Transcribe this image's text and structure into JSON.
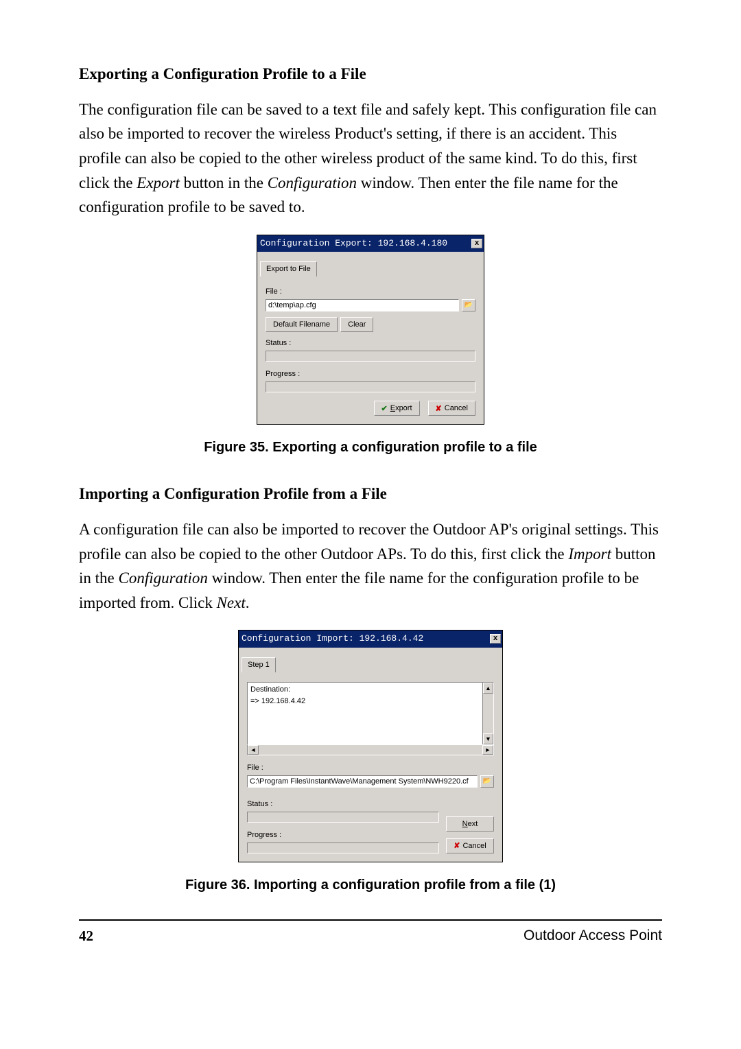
{
  "section1": {
    "heading": "Exporting a Configuration Profile to a File",
    "para_a": "The configuration file can be saved to a text file and safely kept. This configuration file can also be imported to recover the wireless Product's setting, if there is an accident. This profile can also be copied to the other wireless product of the same kind. To do this, first click the ",
    "para_b_ital": "Export",
    "para_c": " button in the ",
    "para_d_ital": "Configuration",
    "para_e": " window. Then enter the file name for the configuration profile to be saved to."
  },
  "dlg1": {
    "title": "Configuration Export: 192.168.4.180",
    "close": "x",
    "tab": "Export to File",
    "file_label": "File :",
    "file_value": "d:\\temp\\ap.cfg",
    "browse_icon": "📂",
    "btn_default": "Default Filename",
    "btn_clear": "Clear",
    "status_label": "Status :",
    "progress_label": "Progress :",
    "btn_export_pre": "E",
    "btn_export_rest": "xport",
    "btn_cancel": "Cancel"
  },
  "fig1": "Figure 35.  Exporting a configuration profile to a file",
  "section2": {
    "heading": "Importing a Configuration Profile from a File",
    "para_a": "A configuration file can also be imported to recover the Outdoor AP's original settings. This profile can also be copied to the other Outdoor APs. To do this, first click the ",
    "para_b_ital": "Import",
    "para_c": " button in the ",
    "para_d_ital": "Configuration",
    "para_e": " window. Then enter the file name for the configuration profile to be imported from. Click ",
    "para_f_ital": "Next",
    "para_g": "."
  },
  "dlg2": {
    "title": "Configuration Import: 192.168.4.42",
    "close": "x",
    "tab": "Step 1",
    "dest_label": "Destination:",
    "dest_value": "=> 192.168.4.42",
    "file_label": "File :",
    "file_value": "C:\\Program Files\\InstantWave\\Management System\\NWH9220.cf",
    "browse_icon": "📂",
    "status_label": "Status :",
    "progress_label": "Progress :",
    "btn_next_pre": "N",
    "btn_next_rest": "ext",
    "btn_cancel": "Cancel"
  },
  "fig2": "Figure 36.  Importing a configuration profile from a file (1)",
  "footer": {
    "page": "42",
    "text": "Outdoor Access Point"
  }
}
